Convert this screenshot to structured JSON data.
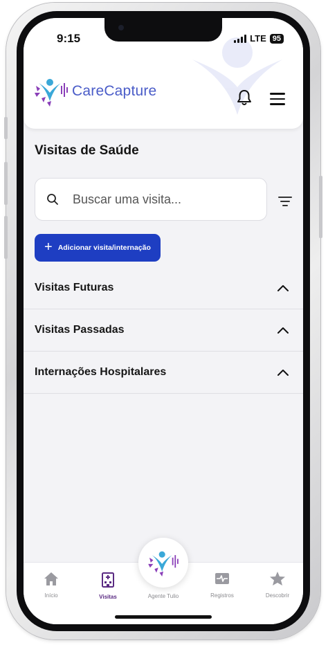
{
  "status_bar": {
    "time": "9:15",
    "network": "LTE",
    "battery": "95"
  },
  "header": {
    "app_name": "CareCapture"
  },
  "page": {
    "title": "Visitas de Saúde"
  },
  "search": {
    "placeholder": "Buscar uma visita..."
  },
  "add_button": {
    "label": "Adicionar visita/internação"
  },
  "sections": [
    {
      "label": "Visitas Futuras",
      "expanded": true
    },
    {
      "label": "Visitas Passadas",
      "expanded": true
    },
    {
      "label": "Internações Hospitalares",
      "expanded": true
    }
  ],
  "bottom_nav": {
    "items": [
      {
        "label": "Início",
        "icon": "home-icon"
      },
      {
        "label": "Visitas",
        "icon": "hospital-icon",
        "active": true
      },
      {
        "label": "Agente Tulio",
        "icon": "carecapture-logo-icon"
      },
      {
        "label": "Registros",
        "icon": "pulse-record-icon"
      },
      {
        "label": "Descobrir",
        "icon": "star-icon"
      }
    ]
  },
  "colors": {
    "brand_blue": "#4a5cc8",
    "primary_button": "#1e3ec2",
    "active_nav": "#5a2a82",
    "logo_purple": "#8a3fb8",
    "logo_teal": "#3aa8d8"
  }
}
